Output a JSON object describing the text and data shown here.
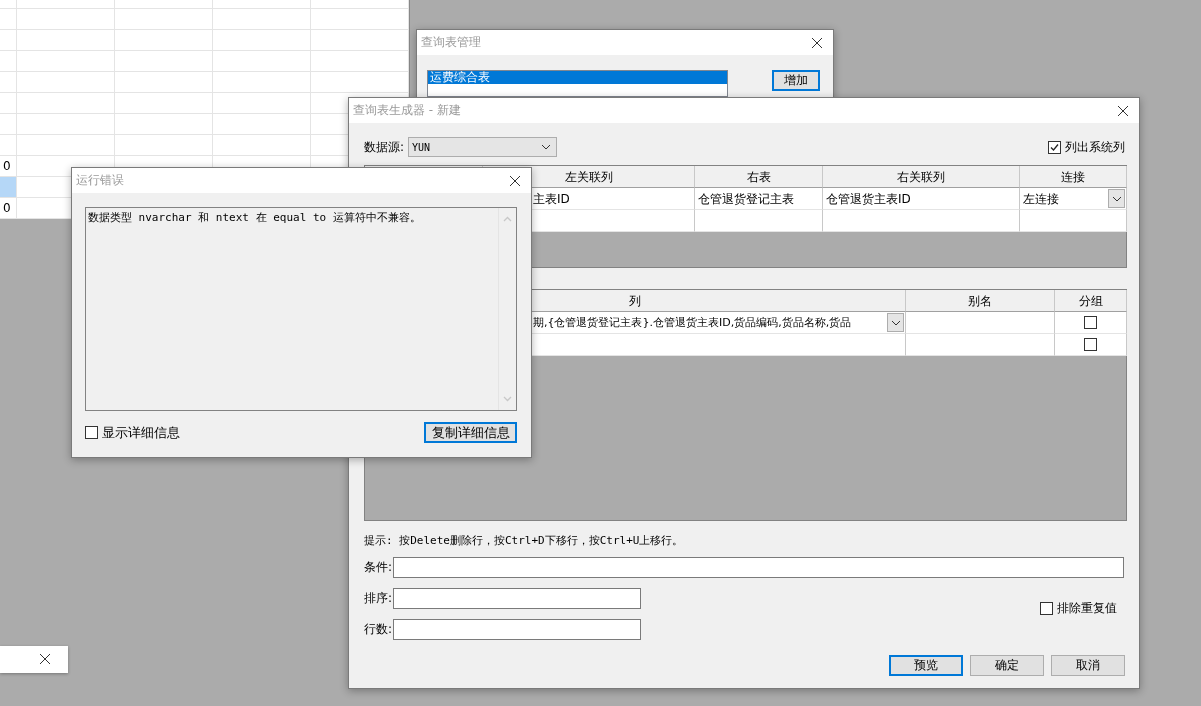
{
  "spreadsheet": {
    "rows": [
      {
        "cells": [
          {
            "text": "0",
            "selected": false
          }
        ]
      },
      {
        "cells": [
          {
            "selected": true
          }
        ]
      },
      {
        "cells": [
          {
            "text": "0",
            "selected": false
          }
        ]
      }
    ]
  },
  "manager_window": {
    "title": "查询表管理",
    "list": [
      {
        "label": "运费综合表",
        "selected": true
      }
    ],
    "add_button": "增加"
  },
  "generator_window": {
    "title": "查询表生成器 - 新建",
    "data_source": {
      "label": "数据源:",
      "value": "YUN"
    },
    "list_system_columns": {
      "label": "列出系统列",
      "checked": true
    },
    "join_table": {
      "columns": [
        "左关联列",
        "右表",
        "右关联列",
        "连接"
      ],
      "rows": [
        {
          "left_column": "主表ID",
          "right_table": "仓管退货登记主表",
          "right_column": "仓管退货主表ID",
          "join": "左连接"
        }
      ]
    },
    "column_table": {
      "columns": [
        "列",
        "别名",
        "分组"
      ],
      "rows": [
        {
          "column": "期,{仓管退货登记主表}.仓管退货主表ID,货品编码,货品名称,货品",
          "group": false
        },
        {
          "group": false
        }
      ]
    },
    "hint": "提示: 按Delete删除行，按Ctrl+D下移行，按Ctrl+U上移行。",
    "fields": [
      {
        "label": "条件:",
        "kind": "wide"
      },
      {
        "label": "排序:",
        "kind": "narrow"
      },
      {
        "label": "行数:",
        "kind": "narrow"
      }
    ],
    "distinct": {
      "label": "排除重复值",
      "checked": false
    },
    "buttons": [
      {
        "label": "预览",
        "default": true
      },
      {
        "label": "确定",
        "default": false
      },
      {
        "label": "取消",
        "default": false
      }
    ]
  },
  "error_window": {
    "title": "运行错误",
    "message": "数据类型 nvarchar 和 ntext 在 equal to 运算符中不兼容。",
    "show_details": {
      "label": "显示详细信息",
      "checked": false
    },
    "copy_button": "复制详细信息"
  }
}
